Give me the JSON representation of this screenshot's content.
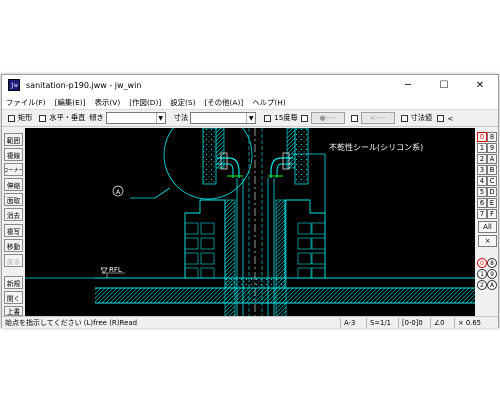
{
  "window": {
    "title": "sanitation-p190.jww - jw_win",
    "icon": "jw-app-icon"
  },
  "controls": {
    "minimize": "─",
    "maximize": "☐",
    "close": "✕"
  },
  "menu": [
    "ファイル(F)",
    "[編集(E)]",
    "表示(V)",
    "[作図(D)]",
    "設定(S)",
    "[その他(A)]",
    "ヘルプ(H)"
  ],
  "toolbar": {
    "rect": "矩形",
    "hv": "水平・垂直",
    "slope": "傾き",
    "dim": "寸法",
    "deg15": "15度毎",
    "dash1": "●----",
    "dash2": "<----",
    "dimval": "寸法値",
    "lt": "<"
  },
  "left_commands": [
    "範囲",
    "複線",
    "コーナー",
    "伸縮",
    "面取",
    "消去",
    "複写",
    "移動",
    "戻る",
    "新規",
    "開く",
    "上書"
  ],
  "right_panel": {
    "buttons": [
      "0",
      "8",
      "1",
      "9",
      "2",
      "A",
      "3",
      "B",
      "4",
      "C",
      "5",
      "D",
      "6",
      "E",
      "7",
      "F"
    ],
    "all": "All",
    "x": "×",
    "circles": [
      "0",
      "8",
      "1",
      "9",
      "2",
      "A"
    ]
  },
  "drawing": {
    "annotation": "不乾性シール(シリコン系)",
    "marker": "A",
    "level": "RFL"
  },
  "status": {
    "message": "始点を指示してください (L)free (R)Read",
    "paper": "A-3",
    "scale": "S=1/1",
    "layer": "[0-0]0",
    "angle": "∠0",
    "zoom": "× 0.65"
  },
  "colors": {
    "canvas": "#000000",
    "lines": "#00e6e6",
    "accent": "#e00000",
    "green": "#00e000",
    "white": "#ffffff"
  }
}
